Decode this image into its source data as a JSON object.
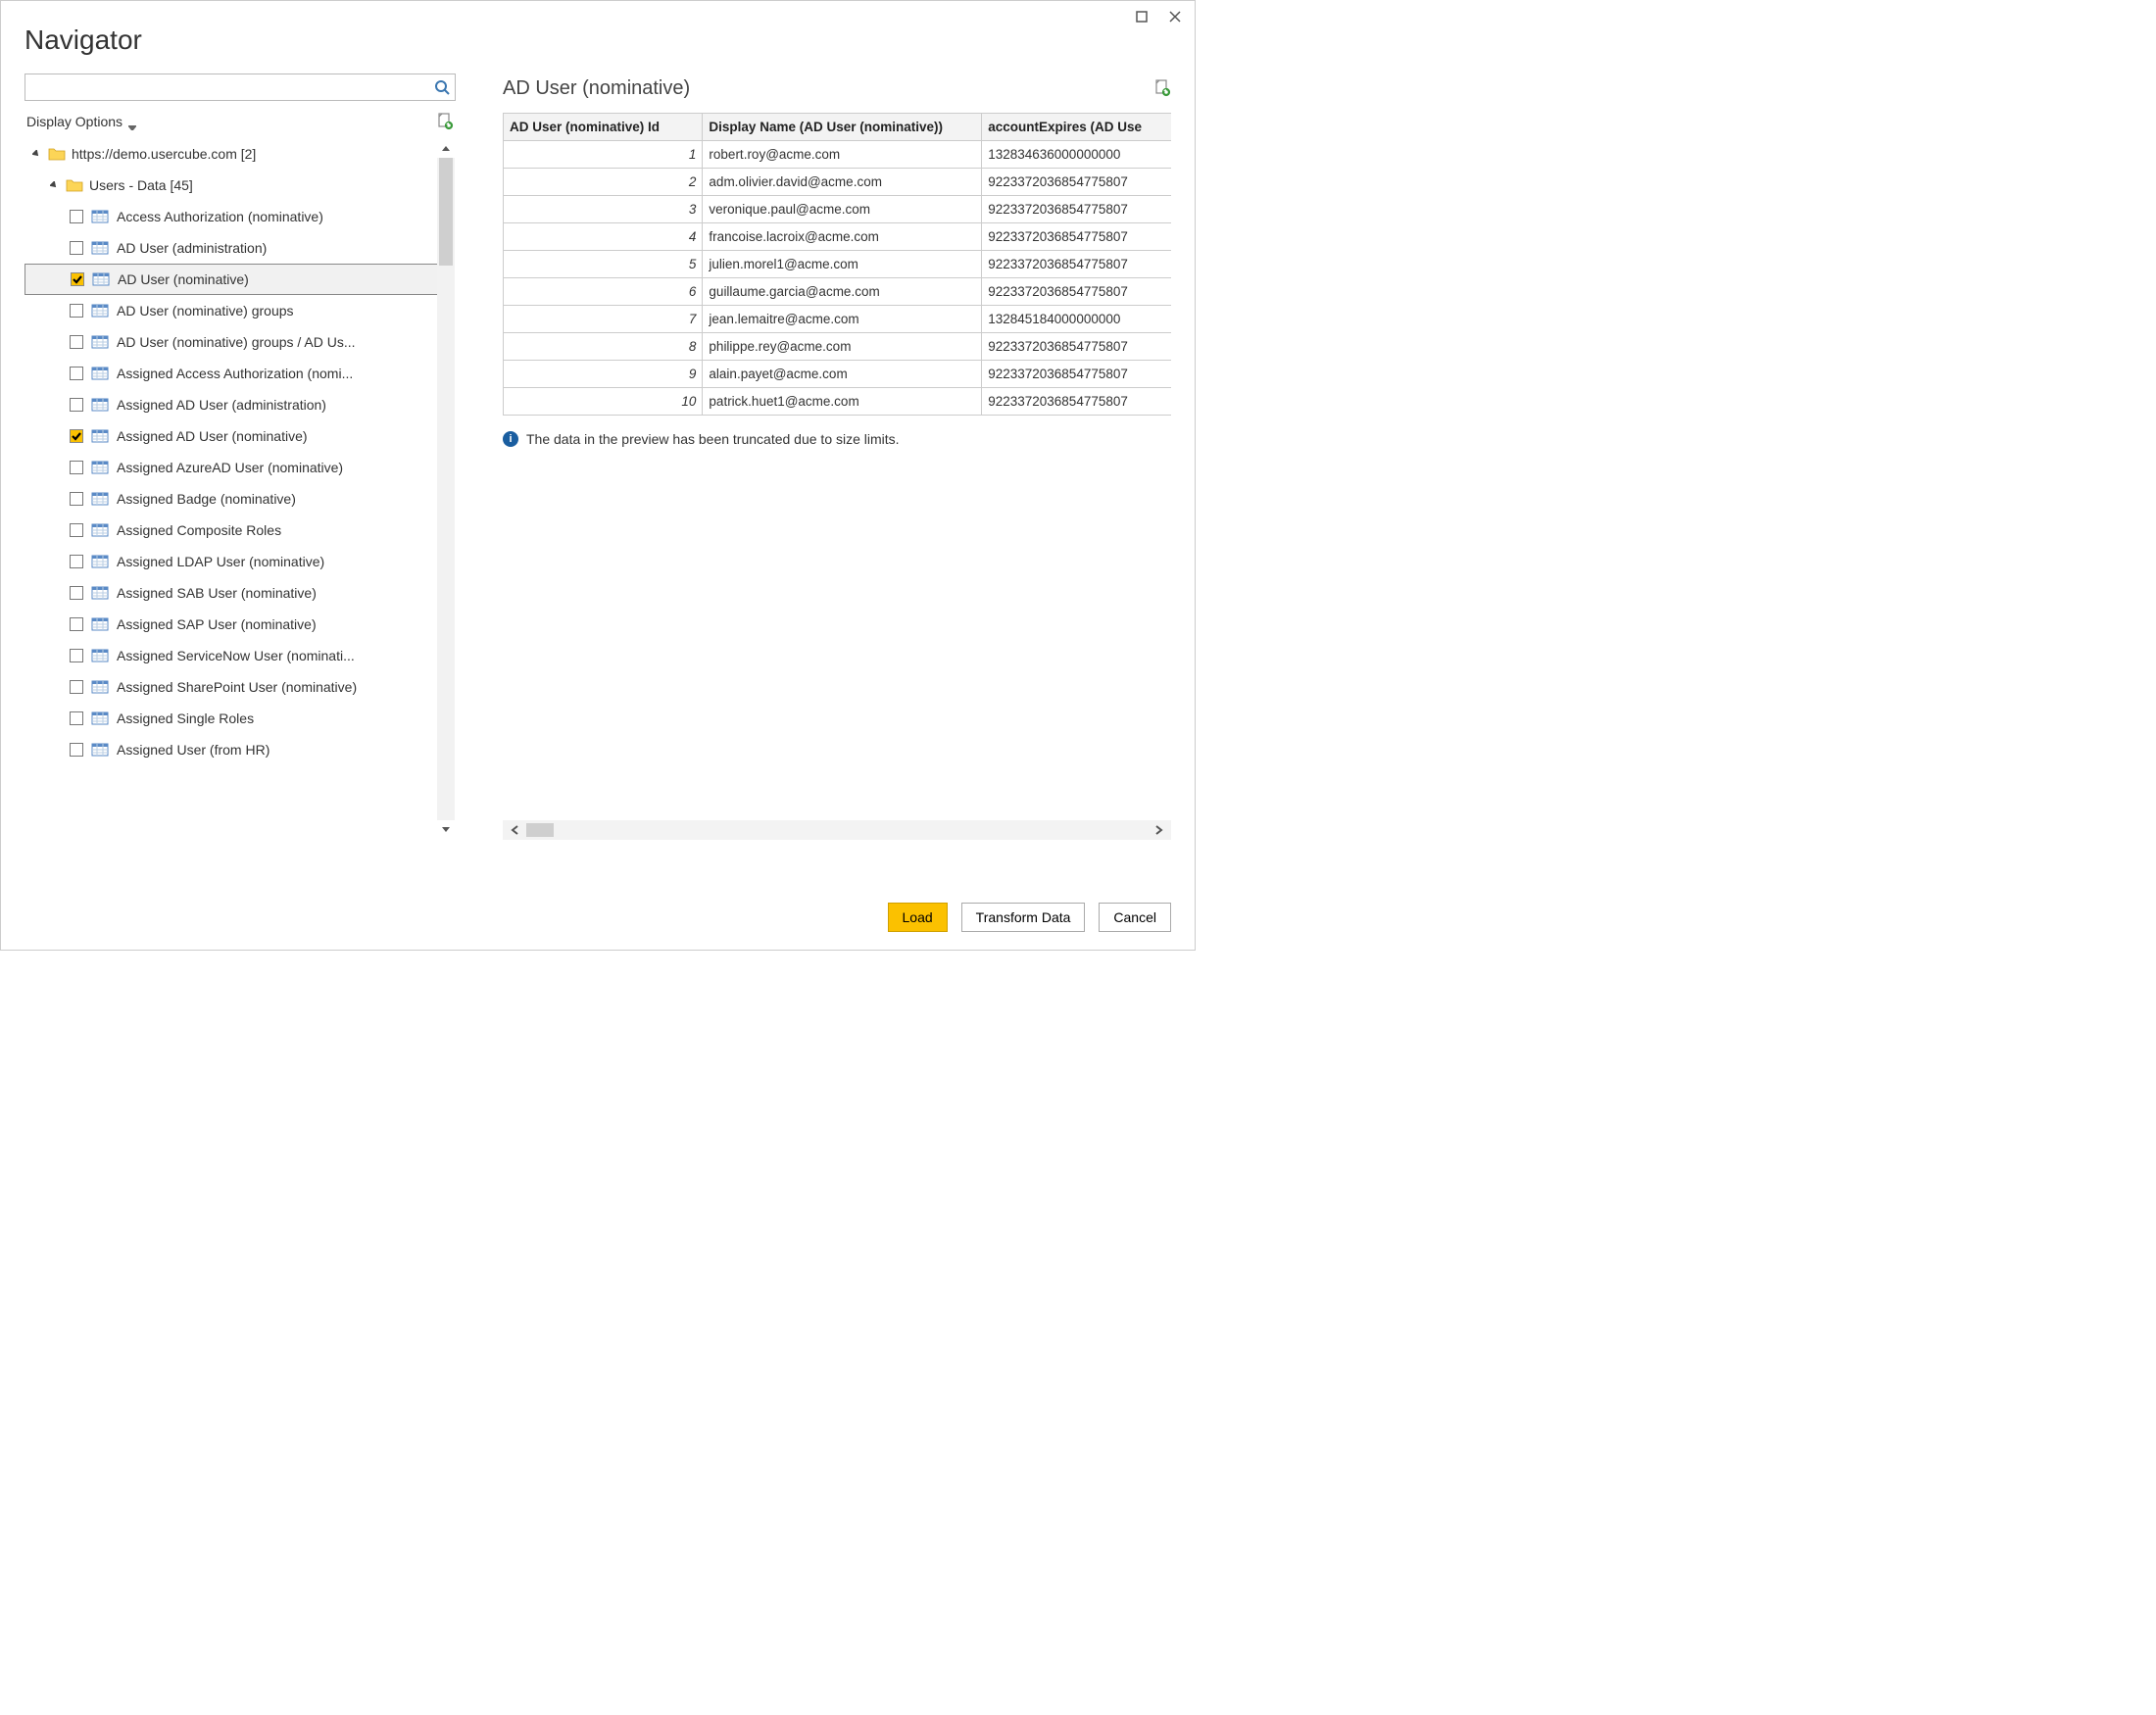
{
  "window": {
    "title": "Navigator"
  },
  "search": {
    "value": ""
  },
  "displayOptions": {
    "label": "Display Options"
  },
  "tree": {
    "root": {
      "label": "https://demo.usercube.com [2]"
    },
    "group": {
      "label": "Users - Data [45]"
    },
    "items": [
      {
        "label": "Access Authorization (nominative)",
        "checked": false,
        "selected": false
      },
      {
        "label": "AD User (administration)",
        "checked": false,
        "selected": false
      },
      {
        "label": "AD User (nominative)",
        "checked": true,
        "selected": true
      },
      {
        "label": "AD User (nominative) groups",
        "checked": false,
        "selected": false
      },
      {
        "label": "AD User (nominative) groups / AD Us...",
        "checked": false,
        "selected": false
      },
      {
        "label": "Assigned Access Authorization (nomi...",
        "checked": false,
        "selected": false
      },
      {
        "label": "Assigned AD User (administration)",
        "checked": false,
        "selected": false
      },
      {
        "label": "Assigned AD User (nominative)",
        "checked": true,
        "selected": false
      },
      {
        "label": "Assigned AzureAD User (nominative)",
        "checked": false,
        "selected": false
      },
      {
        "label": "Assigned Badge (nominative)",
        "checked": false,
        "selected": false
      },
      {
        "label": "Assigned Composite Roles",
        "checked": false,
        "selected": false
      },
      {
        "label": "Assigned LDAP User (nominative)",
        "checked": false,
        "selected": false
      },
      {
        "label": "Assigned SAB User (nominative)",
        "checked": false,
        "selected": false
      },
      {
        "label": "Assigned SAP User (nominative)",
        "checked": false,
        "selected": false
      },
      {
        "label": "Assigned ServiceNow User (nominati...",
        "checked": false,
        "selected": false
      },
      {
        "label": "Assigned SharePoint User (nominative)",
        "checked": false,
        "selected": false
      },
      {
        "label": "Assigned Single Roles",
        "checked": false,
        "selected": false
      },
      {
        "label": "Assigned User (from HR)",
        "checked": false,
        "selected": false
      }
    ]
  },
  "preview": {
    "title": "AD User (nominative)",
    "columns": [
      "AD User (nominative) Id",
      "Display Name (AD User (nominative))",
      "accountExpires (AD Use"
    ],
    "rows": [
      {
        "id": "1",
        "name": "robert.roy@acme.com",
        "expires": "132834636000000000"
      },
      {
        "id": "2",
        "name": "adm.olivier.david@acme.com",
        "expires": "9223372036854775807"
      },
      {
        "id": "3",
        "name": "veronique.paul@acme.com",
        "expires": "9223372036854775807"
      },
      {
        "id": "4",
        "name": "francoise.lacroix@acme.com",
        "expires": "9223372036854775807"
      },
      {
        "id": "5",
        "name": "julien.morel1@acme.com",
        "expires": "9223372036854775807"
      },
      {
        "id": "6",
        "name": "guillaume.garcia@acme.com",
        "expires": "9223372036854775807"
      },
      {
        "id": "7",
        "name": "jean.lemaitre@acme.com",
        "expires": "132845184000000000"
      },
      {
        "id": "8",
        "name": "philippe.rey@acme.com",
        "expires": "9223372036854775807"
      },
      {
        "id": "9",
        "name": "alain.payet@acme.com",
        "expires": "9223372036854775807"
      },
      {
        "id": "10",
        "name": "patrick.huet1@acme.com",
        "expires": "9223372036854775807"
      }
    ],
    "info": "The data in the preview has been truncated due to size limits."
  },
  "footer": {
    "load": "Load",
    "transform": "Transform Data",
    "cancel": "Cancel"
  }
}
